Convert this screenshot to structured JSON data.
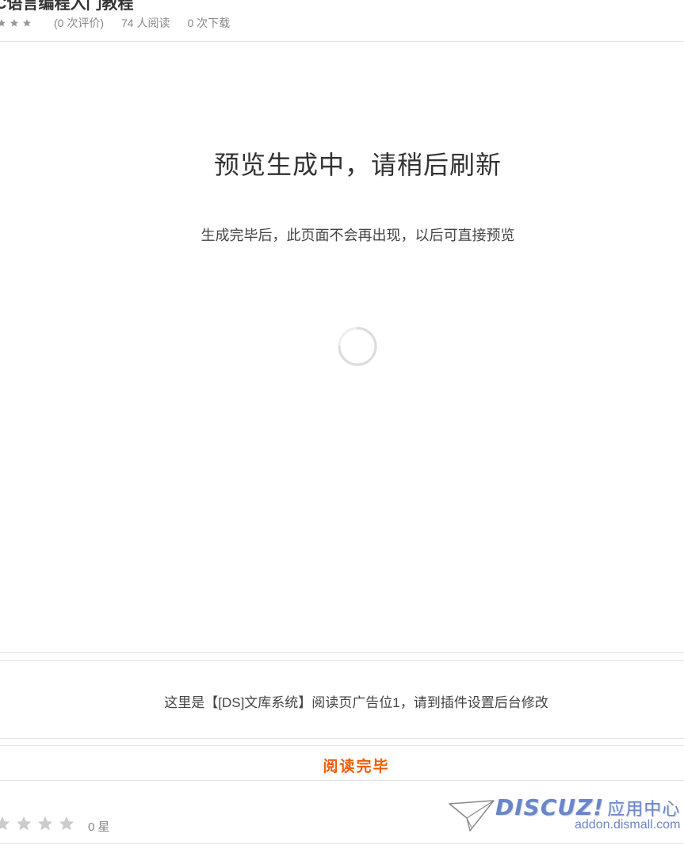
{
  "header": {
    "title": "C语言编程入门教程",
    "ratings_count": "(0 次评价)",
    "views": "74 人阅读",
    "downloads": "0 次下载",
    "mini_star_color": "#999999"
  },
  "preview": {
    "title": "预览生成中，请稍后刷新",
    "subtitle": "生成完毕后，此页面不会再出现，以后可直接预览",
    "spinner_icon": "loading-spinner-icon"
  },
  "ad": {
    "text": "这里是【[DS]文库系统】阅读页广告位1，请到插件设置后台修改"
  },
  "finish": {
    "text": "阅读完毕",
    "color": "#f25c05"
  },
  "rating": {
    "label": "0 星",
    "stars": [
      0,
      0,
      0,
      0
    ],
    "star_color": "#cccccc"
  },
  "logo": {
    "brand": "DISCUZ!",
    "brand_suffix": "应用中心",
    "url": "addon.dismall.com",
    "color": "#6a86c8"
  }
}
